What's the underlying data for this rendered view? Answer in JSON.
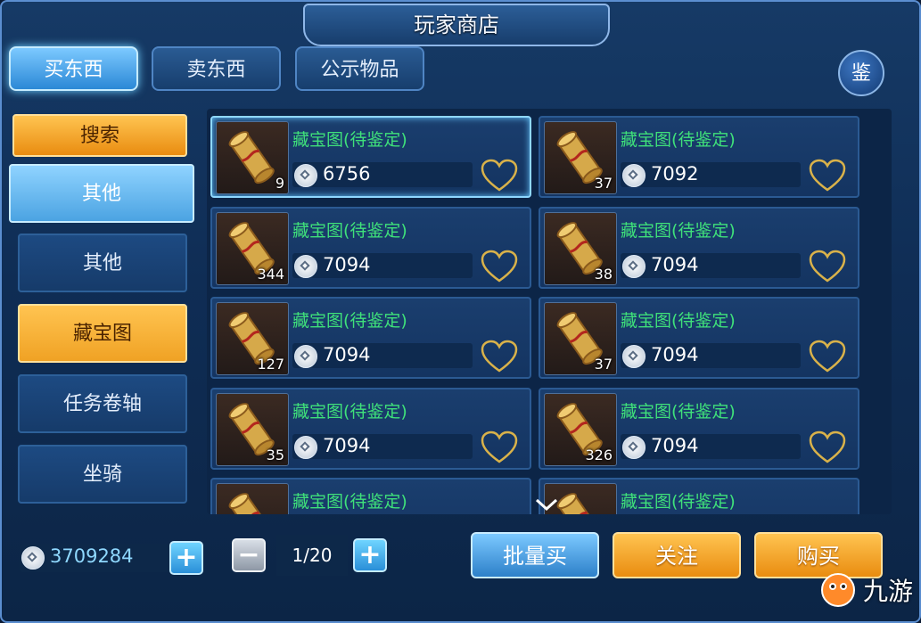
{
  "window": {
    "title": "玩家商店"
  },
  "tabs": [
    {
      "label": "买东西",
      "active": true
    },
    {
      "label": "卖东西",
      "active": false
    },
    {
      "label": "公示物品",
      "active": false
    }
  ],
  "appraise_button": {
    "label": "鉴"
  },
  "sidebar": {
    "search_label": "搜索",
    "parent_category": "其他",
    "items": [
      {
        "label": "其他",
        "selected": false
      },
      {
        "label": "藏宝图",
        "selected": true
      },
      {
        "label": "任务卷轴",
        "selected": false
      },
      {
        "label": "坐骑",
        "selected": false
      }
    ]
  },
  "listings": [
    {
      "name": "藏宝图(待鉴定)",
      "quantity": "9",
      "price": "6756",
      "selected": true
    },
    {
      "name": "藏宝图(待鉴定)",
      "quantity": "37",
      "price": "7092",
      "selected": false
    },
    {
      "name": "藏宝图(待鉴定)",
      "quantity": "344",
      "price": "7094",
      "selected": false
    },
    {
      "name": "藏宝图(待鉴定)",
      "quantity": "38",
      "price": "7094",
      "selected": false
    },
    {
      "name": "藏宝图(待鉴定)",
      "quantity": "127",
      "price": "7094",
      "selected": false
    },
    {
      "name": "藏宝图(待鉴定)",
      "quantity": "37",
      "price": "7094",
      "selected": false
    },
    {
      "name": "藏宝图(待鉴定)",
      "quantity": "35",
      "price": "7094",
      "selected": false
    },
    {
      "name": "藏宝图(待鉴定)",
      "quantity": "326",
      "price": "7094",
      "selected": false
    },
    {
      "name": "藏宝图(待鉴定)",
      "quantity": "",
      "price": "",
      "selected": false
    },
    {
      "name": "藏宝图(待鉴定)",
      "quantity": "",
      "price": "",
      "selected": false
    }
  ],
  "footer": {
    "money": "3709284",
    "page": "1/20",
    "bulk_buy_label": "批量买",
    "follow_label": "关注",
    "buy_label": "购买"
  },
  "watermark": {
    "text": "九游"
  },
  "colors": {
    "item_name": "#3fe07a",
    "accent_orange": "#f0a224",
    "accent_blue": "#4ba3e2"
  },
  "icons": {
    "item": "treasure-map-scroll-icon",
    "currency": "silver-coin-icon",
    "favorite": "heart-outline-icon"
  }
}
